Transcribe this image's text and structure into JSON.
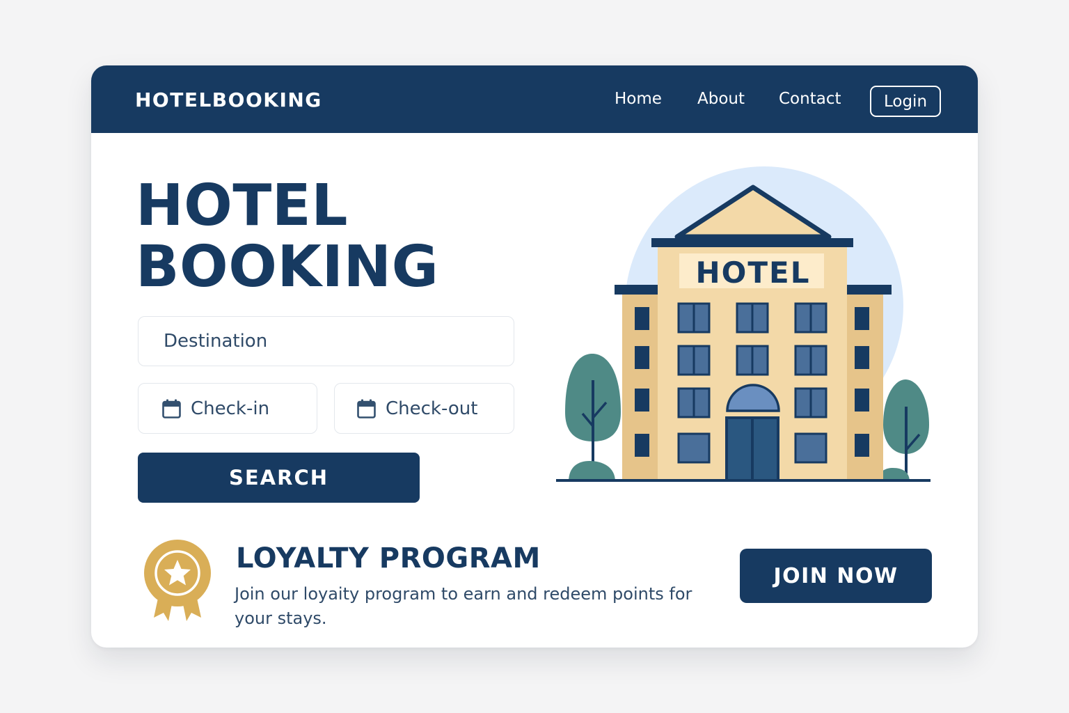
{
  "header": {
    "brand": "HOTELBOOKING",
    "nav": {
      "home": "Home",
      "about": "About",
      "contact": "Contact"
    },
    "login_label": "Login"
  },
  "hero": {
    "title_line1": "HOTEL",
    "title_line2": "BOOKING",
    "search": {
      "destination_placeholder": "Destination",
      "checkin_label": "Check-in",
      "checkout_label": "Check-out",
      "submit_label": "SEARCH"
    },
    "illustration": {
      "sign_text": "HOTEL"
    }
  },
  "loyalty": {
    "title": "LOYALTY PROGRAM",
    "description": "Join our loyaity program to earn and redeem points for your stays.",
    "cta_label": "JOIN NOW"
  },
  "icons": {
    "calendar": "calendar-icon",
    "medal": "award-ribbon-icon"
  },
  "colors": {
    "primary_navy": "#173a61",
    "background": "#f4f4f5",
    "card": "#ffffff",
    "accent_gold": "#d9ae57",
    "building_beige": "#f3d9a8",
    "tree_teal": "#4f8a86",
    "sky_blue": "#dbeafb"
  }
}
